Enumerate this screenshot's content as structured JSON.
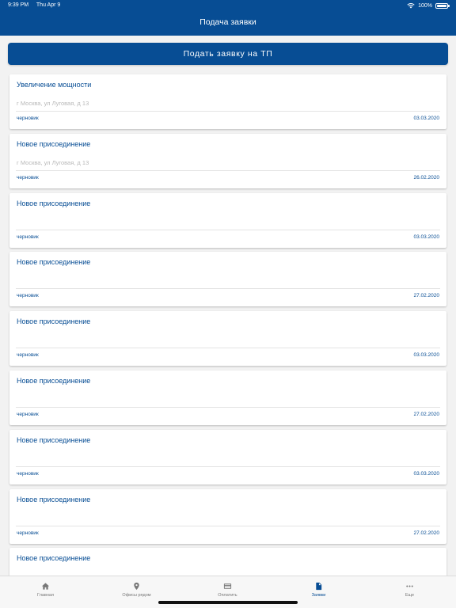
{
  "status_bar": {
    "time": "9:39 PM",
    "date": "Thu Apr 9",
    "battery": "100%"
  },
  "header": {
    "title": "Подача заявки"
  },
  "submit_button": {
    "label": "Подать заявку на ТП"
  },
  "cards": [
    {
      "title": "Увеличение мощности",
      "address": "г Москва, ул Луговая, д 13",
      "status": "черновик",
      "date": "03.03.2020"
    },
    {
      "title": "Новое присоединение",
      "address": "г Москва, ул Луговая, д 13",
      "status": "черновик",
      "date": "26.02.2020"
    },
    {
      "title": "Новое присоединение",
      "address": "",
      "status": "черновик",
      "date": "03.03.2020"
    },
    {
      "title": "Новое присоединение",
      "address": "",
      "status": "черновик",
      "date": "27.02.2020"
    },
    {
      "title": "Новое присоединение",
      "address": "",
      "status": "черновик",
      "date": "03.03.2020"
    },
    {
      "title": "Новое присоединение",
      "address": "",
      "status": "черновик",
      "date": "27.02.2020"
    },
    {
      "title": "Новое присоединение",
      "address": "",
      "status": "черновик",
      "date": "03.03.2020"
    },
    {
      "title": "Новое присоединение",
      "address": "",
      "status": "черновик",
      "date": "27.02.2020"
    },
    {
      "title": "Новое присоединение",
      "address": "",
      "status": "",
      "date": ""
    }
  ],
  "tabs": [
    {
      "label": "Главная",
      "icon": "home-icon"
    },
    {
      "label": "Офисы рядом",
      "icon": "location-pin-icon"
    },
    {
      "label": "Оплатить",
      "icon": "credit-card-icon"
    },
    {
      "label": "Заявки",
      "icon": "document-icon",
      "active": true
    },
    {
      "label": "Еще",
      "icon": "more-icon"
    }
  ],
  "colors": {
    "brand": "#074d94",
    "background": "#f2f2f2",
    "muted_text": "#b8b8b8",
    "tab_inactive": "#777777"
  }
}
